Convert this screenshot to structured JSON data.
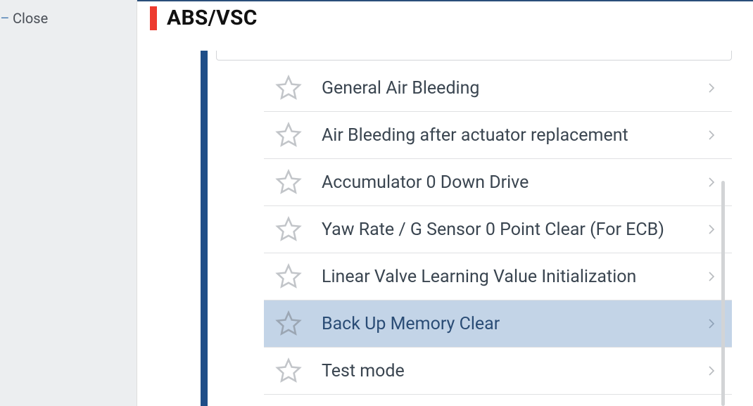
{
  "sidebar": {
    "close_label": "Close"
  },
  "header": {
    "title": "ABS/VSC"
  },
  "items": [
    {
      "label": "General Air Bleeding",
      "selected": false
    },
    {
      "label": "Air Bleeding after actuator replacement",
      "selected": false
    },
    {
      "label": "Accumulator 0 Down Drive",
      "selected": false
    },
    {
      "label": "Yaw Rate / G Sensor 0 Point Clear (For ECB)",
      "selected": false
    },
    {
      "label": "Linear Valve Learning Value Initialization",
      "selected": false
    },
    {
      "label": "Back Up Memory Clear",
      "selected": true
    },
    {
      "label": "Test mode",
      "selected": false
    }
  ],
  "colors": {
    "accent_red": "#ed3b2f",
    "track_blue": "#1f4e88",
    "selected_bg": "#c3d4e7"
  }
}
